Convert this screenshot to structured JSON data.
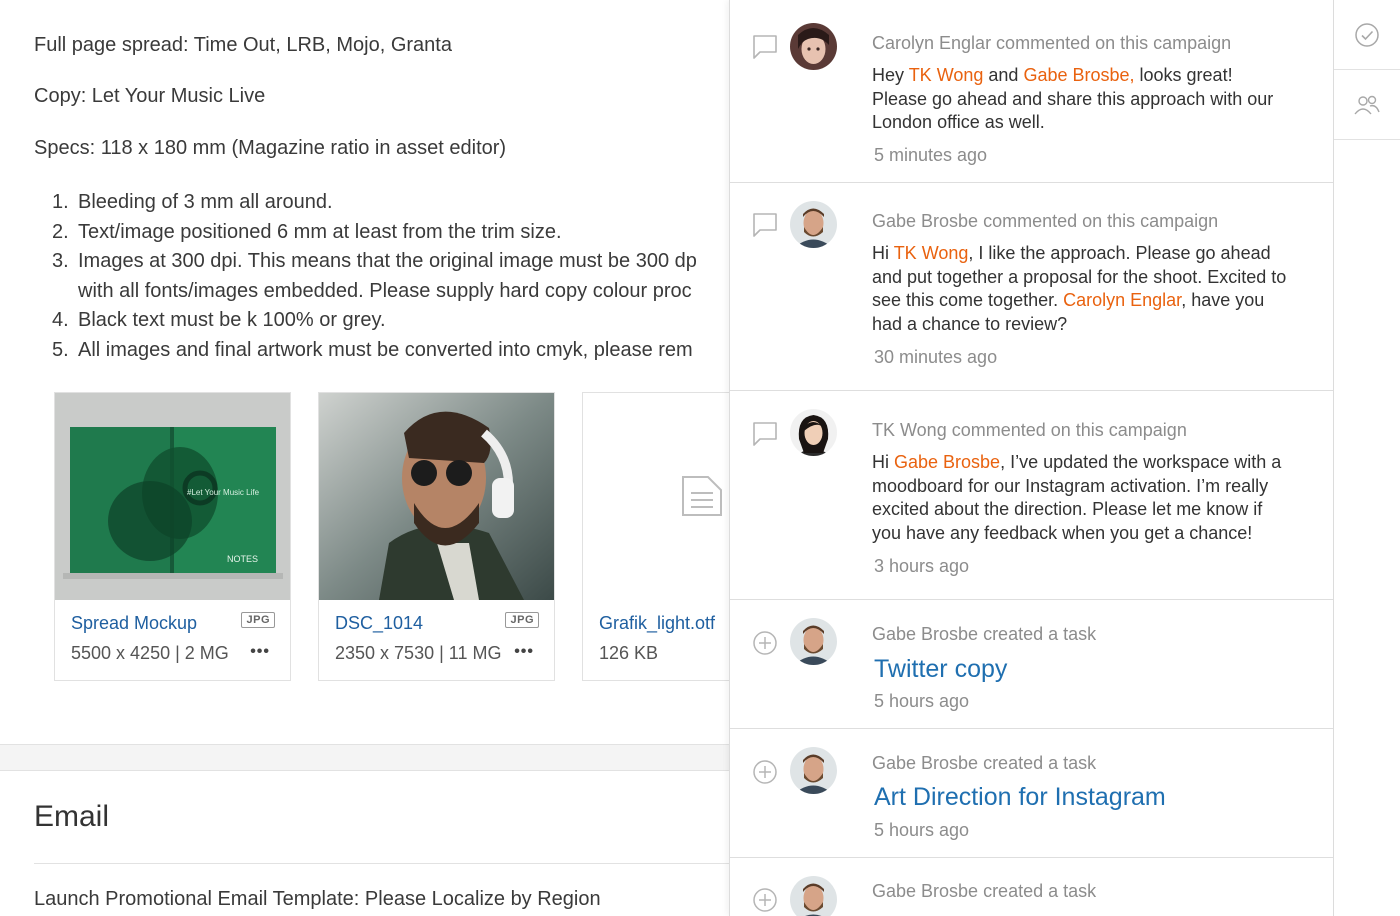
{
  "brief": {
    "line_spread": "Full page spread: Time Out, LRB, Mojo, Granta",
    "line_copy": "Copy: Let Your Music Live",
    "line_specs": "Specs: 118 x 180 mm (Magazine ratio in asset editor)",
    "requirements": [
      {
        "num": "1.",
        "text": "Bleeding of 3 mm all around."
      },
      {
        "num": "2.",
        "text": "Text/image positioned 6 mm at least from the trim size."
      },
      {
        "num": "3.",
        "text": "Images at 300 dpi. This means that the original image must be 300 dp"
      },
      {
        "num": "",
        "text": "with all fonts/images embedded. Please supply hard copy colour proc"
      },
      {
        "num": "4.",
        "text": "Black text must be k 100% or grey."
      },
      {
        "num": "5.",
        "text": "All images and final artwork must be converted into cmyk, please rem"
      }
    ]
  },
  "assets": [
    {
      "name": "Spread Mockup",
      "meta": "5500 x 4250 | 2 MG",
      "badge": "JPG",
      "more": "•••",
      "mockup_caption": "#Let Your Music Life",
      "mockup_footer": "NOTES"
    },
    {
      "name": "DSC_1014",
      "meta": "2350 x 7530 | 11 MG",
      "badge": "JPG",
      "more": "•••"
    },
    {
      "name": "Grafik_light.otf",
      "meta": "126 KB"
    }
  ],
  "email_section": {
    "title": "Email",
    "subtitle": "Launch Promotional Email Template: Please Localize by Region"
  },
  "activity": [
    {
      "type": "comment",
      "header": "Carolyn Englar commented on this campaign",
      "body": [
        {
          "t": "Hey "
        },
        {
          "t": "TK Wong",
          "m": true
        },
        {
          "t": " and "
        },
        {
          "t": "Gabe Brosbe,",
          "m": true
        },
        {
          "t": " looks great! Please go ahead and share this approach with our London office as well."
        }
      ],
      "time": "5 minutes ago"
    },
    {
      "type": "comment",
      "header": "Gabe Brosbe commented on this campaign",
      "body": [
        {
          "t": "Hi "
        },
        {
          "t": "TK Wong",
          "m": true
        },
        {
          "t": ", I like the approach. Please go ahead and put together a proposal for the shoot. Excited to see this come together. "
        },
        {
          "t": "Carolyn Englar",
          "m": true
        },
        {
          "t": ", have you had a chance to review?"
        }
      ],
      "time": "30 minutes ago"
    },
    {
      "type": "comment",
      "header": "TK Wong commented on this campaign",
      "body": [
        {
          "t": "Hi "
        },
        {
          "t": "Gabe Brosbe",
          "m": true
        },
        {
          "t": ", I’ve updated the workspace with a moodboard for our Instagram activation. I’m really excited about the direction. Please let me know if you have any feedback when you get a chance!"
        }
      ],
      "time": "3 hours ago"
    },
    {
      "type": "task",
      "header": "Gabe Brosbe created a task",
      "task_title": "Twitter copy",
      "time": "5 hours ago"
    },
    {
      "type": "task",
      "header": "Gabe Brosbe created a task",
      "task_title": "Art Direction for Instagram",
      "time": "5 hours ago"
    },
    {
      "type": "task",
      "header": "Gabe Brosbe created a task"
    }
  ],
  "colors": {
    "mention": "#e9620f",
    "link": "#1f5fa0",
    "task_link": "#1f6fb0"
  },
  "icons": {
    "comment": "speech-bubble-icon",
    "task": "plus-circle-icon",
    "rail": [
      "checkmark-circle-icon",
      "people-icon"
    ]
  }
}
